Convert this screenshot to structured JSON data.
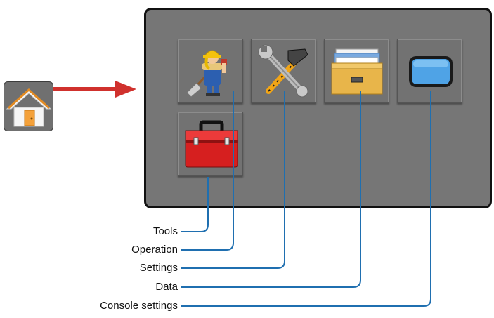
{
  "menu": {
    "tiles": [
      {
        "name": "operation",
        "icon": "worker-icon"
      },
      {
        "name": "settings",
        "icon": "wrench-hammer-icon"
      },
      {
        "name": "data",
        "icon": "file-drawer-icon"
      },
      {
        "name": "console-settings",
        "icon": "monitor-icon"
      },
      {
        "name": "tools",
        "icon": "toolbox-icon"
      }
    ],
    "home_icon": "home-icon"
  },
  "callouts": {
    "tools": "Tools",
    "operation": "Operation",
    "settings": "Settings",
    "data": "Data",
    "console_settings": "Console settings"
  },
  "colors": {
    "arrow": "#d0312d",
    "callout_line": "#1f6fb0",
    "panel": "#767676",
    "home_background": "#707070",
    "house": "#f4a13a"
  }
}
